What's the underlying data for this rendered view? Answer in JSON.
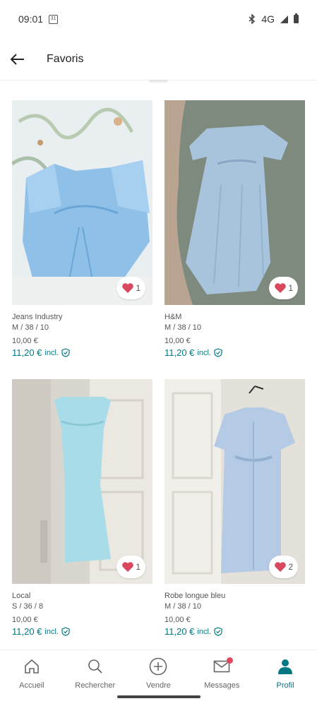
{
  "status_bar": {
    "time": "09:01",
    "calendar_day": "31",
    "network": "4G"
  },
  "header": {
    "title": "Favoris"
  },
  "items": [
    {
      "brand": "Jeans Industry",
      "size": "M / 38 / 10",
      "price": "10,00 €",
      "price_incl": "11,20 €",
      "incl_label": "incl.",
      "favorites": "1"
    },
    {
      "brand": "H&M",
      "size": "M / 38 / 10",
      "price": "10,00 €",
      "price_incl": "11,20 €",
      "incl_label": "incl.",
      "favorites": "1"
    },
    {
      "brand": "Local",
      "size": "S / 36 / 8",
      "price": "10,00 €",
      "price_incl": "11,20 €",
      "incl_label": "incl.",
      "favorites": "1"
    },
    {
      "brand": "Robe longue bleu",
      "size": "M / 38 / 10",
      "price": "10,00 €",
      "price_incl": "11,20 €",
      "incl_label": "incl.",
      "favorites": "2"
    }
  ],
  "nav": {
    "home": "Accueil",
    "search": "Rechercher",
    "sell": "Vendre",
    "messages": "Messages",
    "profile": "Profil"
  },
  "colors": {
    "accent": "#007782",
    "heart": "#d9485e",
    "notification": "#e0495d"
  }
}
